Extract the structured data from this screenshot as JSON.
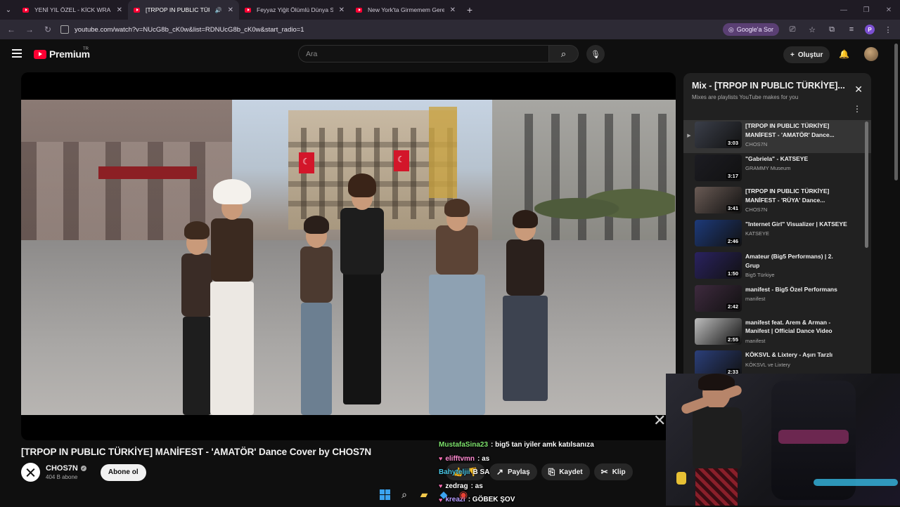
{
  "browser": {
    "tabs": [
      {
        "title": "YENİ YIL ÖZEL - KİCK WRAPPED",
        "active": false,
        "audio": false
      },
      {
        "title": "[TRPOP IN PUBLIC TÜRKİYE]",
        "active": true,
        "audio": true
      },
      {
        "title": "Feyyaz Yiğit Ölümlü Dünya Sah",
        "active": false,
        "audio": false
      },
      {
        "title": "New York'ta Girmemem Gerek",
        "active": false,
        "audio": false
      }
    ],
    "url": "youtube.com/watch?v=NUcG8b_cK0w&list=RDNUcG8b_cK0w&start_radio=1",
    "google_pill": "Google'a Sor",
    "profile_initial": "P"
  },
  "masthead": {
    "brand": "Premium",
    "region": "TR",
    "search_placeholder": "Ara",
    "create_label": "Oluştur"
  },
  "video": {
    "title": "[TRPOP IN PUBLIC TÜRKİYE] MANİFEST - 'AMATÖR' Dance Cover by CHOS7N",
    "channel": "CHOS7N",
    "subscribers": "404 B abone",
    "subscribe_label": "Abone ol",
    "actions": {
      "share": "Paylaş",
      "save": "Kaydet",
      "clip": "Klip"
    }
  },
  "chat": [
    {
      "user": "MustafaSina23",
      "msg": ": big5 tan iyiler amk katılsanıza",
      "color": "#7ee36d",
      "heart": false
    },
    {
      "user": "elifftvmn",
      "msg": ": as",
      "color": "#ff8ad0",
      "heart": true
    },
    {
      "user": "Bahyteljii",
      "msg": "B SA",
      "color": "#49c6e5",
      "heart": false
    },
    {
      "user": "zedrag",
      "msg": ": as",
      "color": "#ffffff",
      "heart": true
    },
    {
      "user": "kreazi",
      "msg": ": GÖBEK ŞOV",
      "color": "#b69cff",
      "heart": true
    }
  ],
  "mix": {
    "title": "Mix - [TRPOP IN PUBLIC TÜRKİYE]...",
    "subtitle": "Mixes are playlists YouTube makes for you",
    "items": [
      {
        "title": "[TRPOP IN PUBLIC TÜRKİYE] MANİFEST - 'AMATÖR' Dance...",
        "channel": "CHOS7N",
        "duration": "3:03",
        "current": true,
        "thumb": "#3b3f4a"
      },
      {
        "title": "\"Gabriela\" - KATSEYE",
        "channel": "GRAMMY Museum",
        "duration": "3:17",
        "current": false,
        "thumb": "#1c1c22"
      },
      {
        "title": "[TRPOP IN PUBLIC TÜRKİYE] MANİFEST - 'RÜYA' Dance...",
        "channel": "CHOS7N",
        "duration": "3:41",
        "current": false,
        "thumb": "#6a5b55"
      },
      {
        "title": "\"Internet Girl\" Visualizer | KATSEYE",
        "channel": "KATSEYE",
        "duration": "2:46",
        "current": false,
        "thumb": "#1d3a7a"
      },
      {
        "title": "Amateur (Big5 Performans) | 2. Grup",
        "channel": "Big5 Türkiye",
        "duration": "1:50",
        "current": false,
        "thumb": "#2a2260"
      },
      {
        "title": "manifest - Big5 Özel Performans",
        "channel": "manifest",
        "duration": "2:42",
        "current": false,
        "thumb": "#3e2a3e"
      },
      {
        "title": "manifest feat. Arem & Arman - Manifest | Official Dance Video",
        "channel": "manifest",
        "duration": "2:55",
        "current": false,
        "thumb": "#bdbdbd"
      },
      {
        "title": "KÖKSVL & Lixtery - Aşırı Tarzlı",
        "channel": "KÖKSVL ve Lixtery",
        "duration": "2:33",
        "current": false,
        "thumb": "#2b3f7a"
      }
    ]
  }
}
